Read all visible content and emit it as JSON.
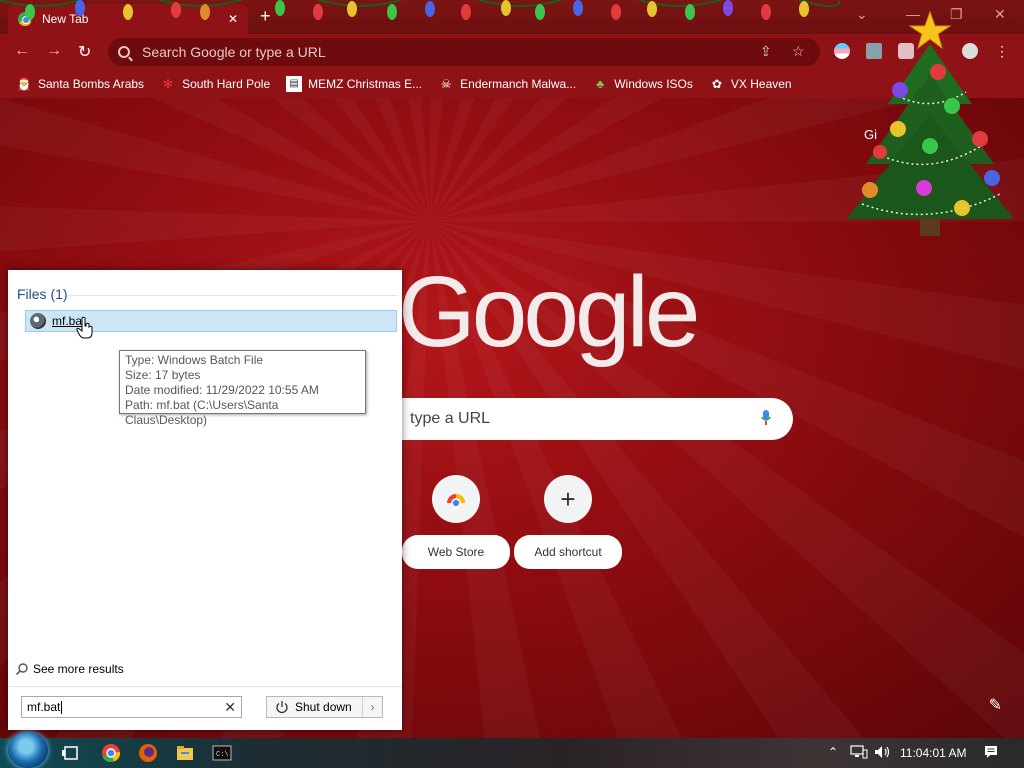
{
  "browser": {
    "tab_title": "New Tab",
    "omnibox_placeholder": "Search Google or type a URL",
    "bookmarks": [
      {
        "label": "Santa Bombs Arabs",
        "icon": "santa-icon"
      },
      {
        "label": "South Hard Pole",
        "icon": "snowflake-icon"
      },
      {
        "label": "MEMZ Christmas E...",
        "icon": "page-icon"
      },
      {
        "label": "Endermanch Malwa...",
        "icon": "skull-icon"
      },
      {
        "label": "Windows ISOs",
        "icon": "elf-icon"
      },
      {
        "label": "VX Heaven",
        "icon": "vx-icon"
      }
    ],
    "ntp": {
      "logo_text": "Google",
      "search_placeholder_fragment": "type a URL",
      "shortcuts": [
        {
          "label": "Web Store",
          "icon": "web-store-icon"
        },
        {
          "label": "Add shortcut",
          "icon": "plus-icon"
        }
      ],
      "gmail_fragment": "Gi"
    }
  },
  "start_search": {
    "group_header": "Files (1)",
    "result_name": "mf.bat",
    "tooltip": {
      "type": "Type: Windows Batch File",
      "size": "Size: 17 bytes",
      "modified": "Date modified: 11/29/2022 10:55 AM",
      "path": "Path: mf.bat (C:\\Users\\Santa Claus\\Desktop)"
    },
    "see_more": "See more results",
    "query": "mf.bat",
    "shutdown_label": "Shut down"
  },
  "taskbar": {
    "clock": "11:04:01 AM",
    "pinned": [
      "ie-icon",
      "chrome-icon",
      "firefox-icon",
      "explorer-icon",
      "cmd-icon"
    ]
  },
  "colors": {
    "browser_red": "#8e1216",
    "selection_blue": "#cce6f6",
    "files_header_blue": "#1e4e8c"
  }
}
